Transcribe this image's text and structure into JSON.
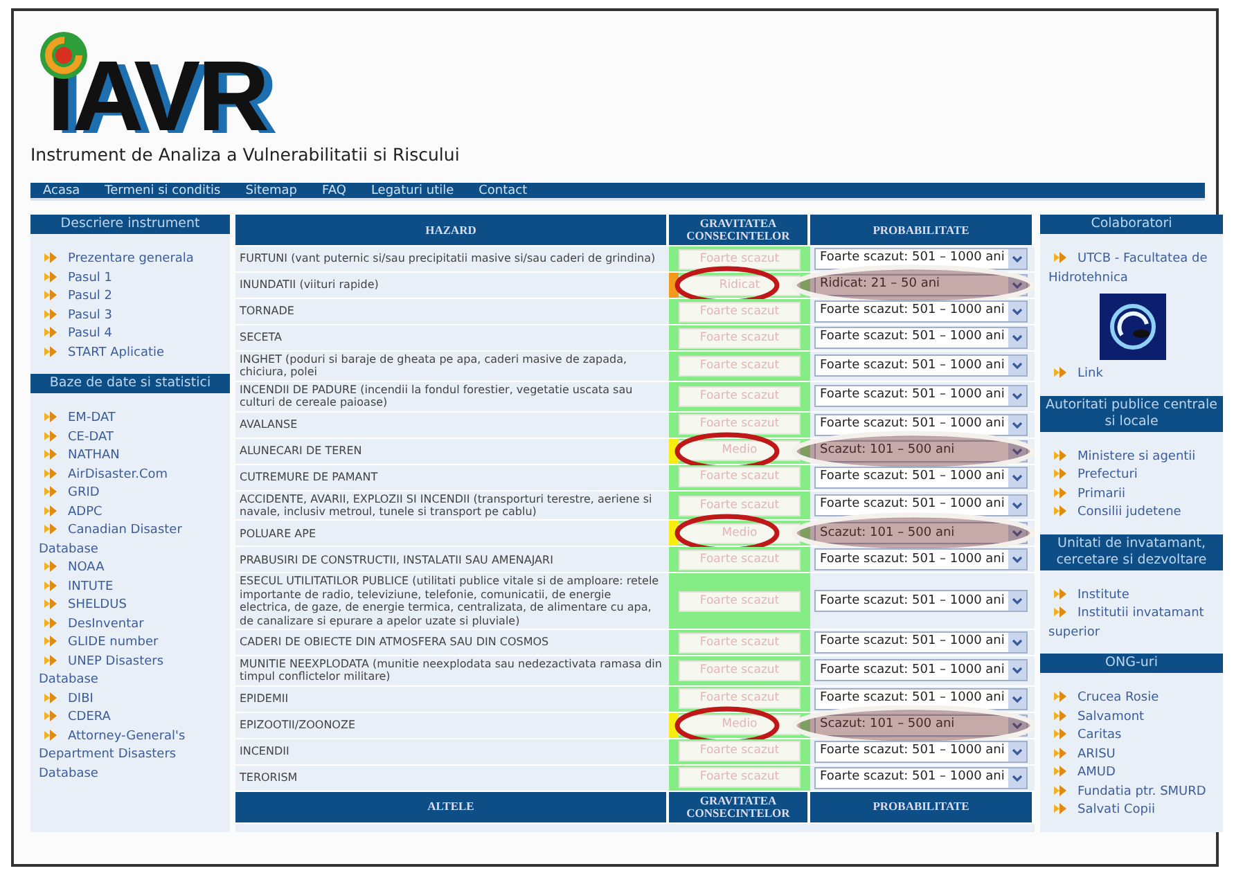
{
  "header": {
    "logo_text": "IAVR",
    "subtitle": "Instrument de Analiza a Vulnerabilitatii si Riscului"
  },
  "nav": [
    "Acasa",
    "Termeni si conditis",
    "Sitemap",
    "FAQ",
    "Legaturi utile",
    "Contact"
  ],
  "left_sidebar": [
    {
      "title": "Descriere instrument",
      "items": [
        "Prezentare generala",
        "Pasul 1",
        "Pasul 2",
        "Pasul 3",
        "Pasul 4",
        "START Aplicatie"
      ]
    },
    {
      "title": "Baze de date si statistici",
      "items": [
        "EM-DAT",
        "CE-DAT",
        "NATHAN",
        "AirDisaster.Com",
        "GRID",
        "ADPC",
        "Canadian Disaster Database",
        "NOAA",
        "INTUTE",
        "SHELDUS",
        "DesInventar",
        "GLIDE number",
        "UNEP Disasters Database",
        "DIBI",
        "CDERA",
        "Attorney-General's Department Disasters Database"
      ]
    }
  ],
  "table": {
    "columns": [
      "HAZARD",
      "GRAVITATEA CONSECINTELOR",
      "PROBABILITATE"
    ],
    "rows": [
      {
        "hazard": "FURTUNI (vant puternic si/sau precipitatii masive si/sau caderi de grindina)",
        "gravity": "Foarte scazut",
        "probability": "Foarte scazut: 501 – 1000 ani",
        "highlighted": false
      },
      {
        "hazard": "INUNDATII (viituri rapide)",
        "gravity": "Ridicat",
        "probability": "Ridicat: 21 – 50 ani",
        "highlighted": true,
        "color": "#f39a1c"
      },
      {
        "hazard": "TORNADE",
        "gravity": "Foarte scazut",
        "probability": "Foarte scazut: 501 – 1000 ani",
        "highlighted": false
      },
      {
        "hazard": "SECETA",
        "gravity": "Foarte scazut",
        "probability": "Foarte scazut: 501 – 1000 ani",
        "highlighted": false
      },
      {
        "hazard": "INGHET (poduri si baraje de gheata pe apa, caderi masive de zapada, chiciura, polei",
        "gravity": "Foarte scazut",
        "probability": "Foarte scazut: 501 – 1000 ani",
        "highlighted": false
      },
      {
        "hazard": "INCENDII DE PADURE (incendii la fondul forestier, vegetatie uscata sau culturi de cereale paioase)",
        "gravity": "Foarte scazut",
        "probability": "Foarte scazut: 501 – 1000 ani",
        "highlighted": false
      },
      {
        "hazard": "AVALANSE",
        "gravity": "Foarte scazut",
        "probability": "Foarte scazut: 501 – 1000 ani",
        "highlighted": false
      },
      {
        "hazard": "ALUNECARI DE TEREN",
        "gravity": "Medio",
        "probability": "Scazut: 101 – 500 ani",
        "highlighted": true,
        "color": "#f5ee10"
      },
      {
        "hazard": "CUTREMURE DE PAMANT",
        "gravity": "Foarte scazut",
        "probability": "Foarte scazut: 501 – 1000 ani",
        "highlighted": false
      },
      {
        "hazard": "ACCIDENTE, AVARII, EXPLOZII SI INCENDII (transporturi terestre, aeriene si navale, inclusiv metroul, tunele si transport pe cablu)",
        "gravity": "Foarte scazut",
        "probability": "Foarte scazut: 501 – 1000 ani",
        "highlighted": false
      },
      {
        "hazard": "POLUARE APE",
        "gravity": "Medio",
        "probability": "Scazut: 101 – 500 ani",
        "highlighted": true,
        "color": "#f5ee10"
      },
      {
        "hazard": "PRABUSIRI DE CONSTRUCTII, INSTALATII SAU AMENAJARI",
        "gravity": "Foarte scazut",
        "probability": "Foarte scazut: 501 – 1000 ani",
        "highlighted": false
      },
      {
        "hazard": "ESECUL UTILITATILOR PUBLICE (utilitati publice vitale si de amploare: retele importante de radio, televiziune, telefonie, comunicatii, de energie electrica, de gaze, de energie termica, centralizata, de alimentare cu apa, de canalizare si epurare a apelor uzate si pluviale)",
        "gravity": "Foarte scazut",
        "probability": "Foarte scazut: 501 – 1000 ani",
        "highlighted": false
      },
      {
        "hazard": "CADERI DE OBIECTE DIN ATMOSFERA SAU DIN COSMOS",
        "gravity": "Foarte scazut",
        "probability": "Foarte scazut: 501 – 1000 ani",
        "highlighted": false
      },
      {
        "hazard": "MUNITIE NEEXPLODATA (munitie neexplodata sau nedezactivata ramasa din timpul conflictelor militare)",
        "gravity": "Foarte scazut",
        "probability": "Foarte scazut: 501 – 1000 ani",
        "highlighted": false
      },
      {
        "hazard": "EPIDEMII",
        "gravity": "Foarte scazut",
        "probability": "Foarte scazut: 501 – 1000 ani",
        "highlighted": false
      },
      {
        "hazard": "EPIZOOTII/ZOONOZE",
        "gravity": "Medio",
        "probability": "Scazut: 101 – 500 ani",
        "highlighted": true,
        "color": "#f5ee10"
      },
      {
        "hazard": "INCENDII",
        "gravity": "Foarte scazut",
        "probability": "Foarte scazut: 501 – 1000 ani",
        "highlighted": false
      },
      {
        "hazard": "TERORISM",
        "gravity": "Foarte scazut",
        "probability": "Foarte scazut: 501 – 1000 ani",
        "highlighted": false
      }
    ],
    "footer_columns": [
      "ALTELE",
      "GRAVITATEA CONSECINTELOR",
      "PROBABILITATE"
    ]
  },
  "right_sidebar": [
    {
      "title": "Colaboratori",
      "items": [
        {
          "kind": "link",
          "text": "UTCB - Facultatea de Hidrotehnica"
        },
        {
          "kind": "logo"
        },
        {
          "kind": "link",
          "text": "Link"
        }
      ]
    },
    {
      "title": "Autoritati publice centrale si locale",
      "items": [
        {
          "kind": "link",
          "text": "Ministere si agentii"
        },
        {
          "kind": "link",
          "text": "Prefecturi"
        },
        {
          "kind": "link",
          "text": "Primarii"
        },
        {
          "kind": "link",
          "text": "Consilii judetene"
        }
      ]
    },
    {
      "title": "Unitati de invatamant, cercetare si dezvoltare",
      "items": [
        {
          "kind": "link",
          "text": "Institute"
        },
        {
          "kind": "link",
          "text": "Institutii invatamant superior"
        }
      ]
    },
    {
      "title": "ONG-uri",
      "items": [
        {
          "kind": "link",
          "text": "Crucea Rosie"
        },
        {
          "kind": "link",
          "text": "Salvamont"
        },
        {
          "kind": "link",
          "text": "Caritas"
        },
        {
          "kind": "link",
          "text": "ARISU"
        },
        {
          "kind": "link",
          "text": "AMUD"
        },
        {
          "kind": "link",
          "text": "Fundatia ptr. SMURD"
        },
        {
          "kind": "link",
          "text": "Salvati Copii"
        }
      ]
    }
  ]
}
